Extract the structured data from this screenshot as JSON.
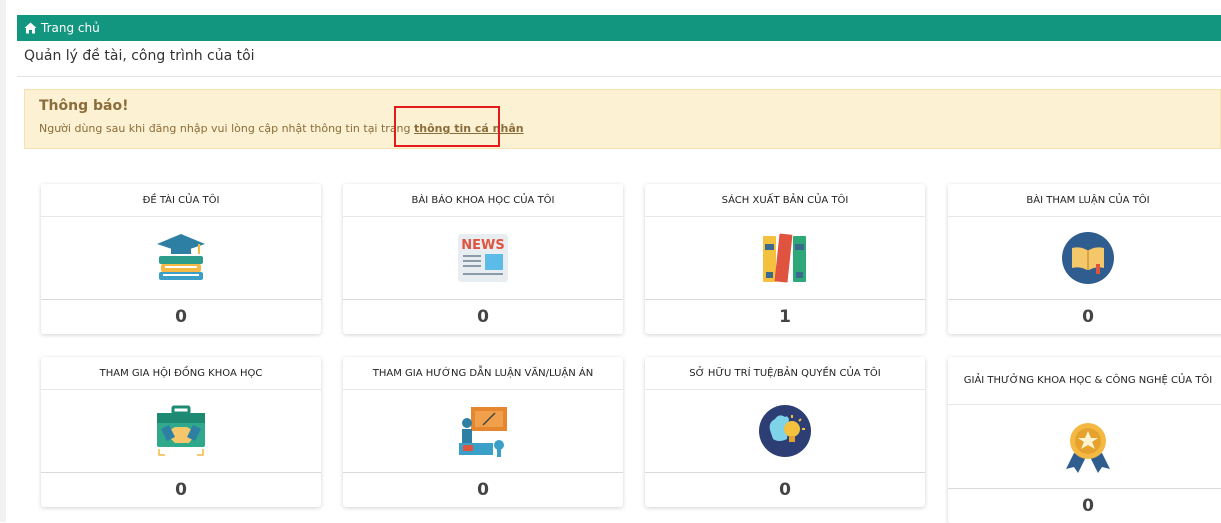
{
  "breadcrumb": {
    "home_label": "Trang chủ"
  },
  "page_title": "Quản lý đề tài, công trình của tôi",
  "alert": {
    "title": "Thông báo!",
    "message": "Người dùng sau khi đăng nhập vui lòng cập nhật thông tin tại trang",
    "link_label": "thông tin cá nhân"
  },
  "cards": [
    {
      "title": "ĐỀ TÀI CỦA TÔI",
      "count": "0",
      "icon": "graduation-books-icon"
    },
    {
      "title": "BÀI BÁO KHOA HỌC CỦA TÔI",
      "count": "0",
      "icon": "news-icon"
    },
    {
      "title": "SÁCH XUẤT BẢN CỦA TÔI",
      "count": "1",
      "icon": "binders-icon"
    },
    {
      "title": "BÀI THAM LUẬN CỦA TÔI",
      "count": "0",
      "icon": "open-book-icon"
    },
    {
      "title": "THAM GIA HỘI ĐỒNG KHOA HỌC",
      "count": "0",
      "icon": "handshake-briefcase-icon"
    },
    {
      "title": "THAM GIA HƯỚNG DẪN LUẬN VĂN/LUẬN ÁN",
      "count": "0",
      "icon": "presentation-icon"
    },
    {
      "title": "SỞ HỮU TRÍ TUỆ/BẢN QUYỀN CỦA TÔI",
      "count": "0",
      "icon": "brain-lightbulb-icon"
    },
    {
      "title": "GIẢI THƯỞNG KHOA HỌC & CÔNG NGHỆ CỦA TÔI",
      "count": "0",
      "icon": "award-medal-icon"
    }
  ],
  "colors": {
    "header": "#13967f",
    "alert_bg": "#fcf1d2",
    "alert_text": "#8a6d3b",
    "highlight": "#e31b1b"
  }
}
